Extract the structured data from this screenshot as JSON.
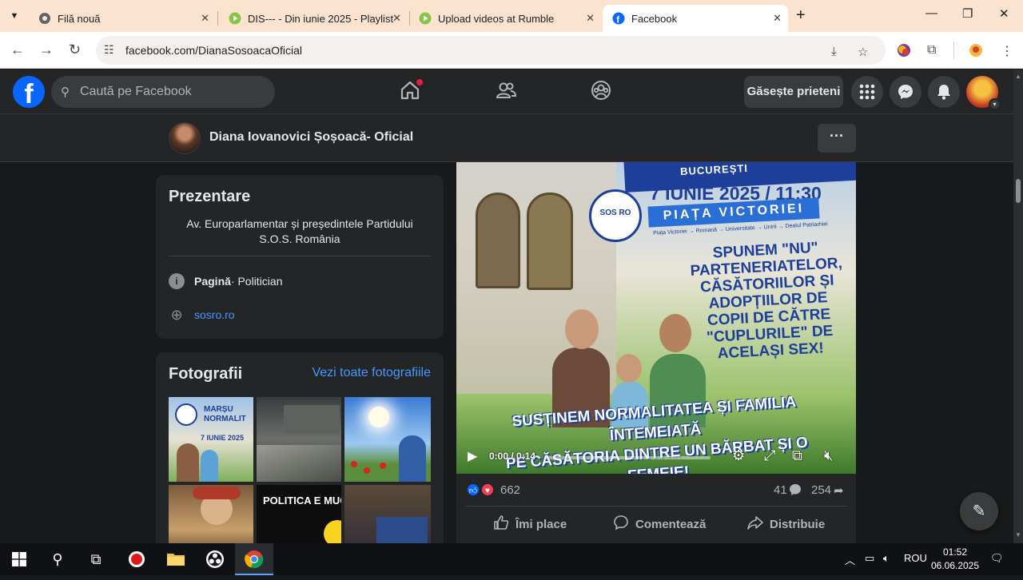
{
  "browser": {
    "tabs": [
      {
        "title": "Filă nouă"
      },
      {
        "title": "DIS--- - Din iunie 2025 - Playlist"
      },
      {
        "title": "Upload videos at Rumble"
      },
      {
        "title": "Facebook"
      }
    ],
    "url": "facebook.com/DianaSosoacaOficial"
  },
  "facebook": {
    "search_placeholder": "Caută pe Facebook",
    "find_friends_label": "Găsește prieteni"
  },
  "page": {
    "name": "Diana Iovanovici Șoșoacă- Oficial",
    "more_label": "···"
  },
  "intro": {
    "title": "Prezentare",
    "bio": "Av. Europarlamentar și președintele Partidului S.O.S. România",
    "category_bold": "Pagină",
    "category_rest": " · Politician",
    "website": "sosro.ro"
  },
  "photos": {
    "title": "Fotografii",
    "see_all": "Vezi toate fotografiile",
    "thumb1_text": "MARȘU NORMALIT",
    "thumb1_date": "7 IUNIE 2025",
    "thumb4_text": "POLITICA E MUCI"
  },
  "video": {
    "banner": "BUCUREȘTI",
    "logo_text": "SOS RO",
    "date_text": "7 IUNIE 2025 / 11:30",
    "place": "PIAȚA VICTORIEI",
    "route": "Piața Victoriei → Romană → Universitate → Unirii → Dealul Patriarhiei",
    "message": "SPUNEM \"NU\" PARTENERIATELOR, CĂSĂTORIILOR ȘI ADOPȚIILOR DE COPII DE CĂTRE \"CUPLURILE\" DE ACELAȘI SEX!",
    "bottom_line1": "SUSȚINEM NORMALITATEA ȘI FAMILIA ÎNTEMEIATĂ",
    "bottom_line2": "PE CĂSĂTORIA DINTRE UN BĂRBAT ȘI O FEMEIE!",
    "time": "0:00 / 0:14"
  },
  "post": {
    "reactions_count": "662",
    "comments_count": "41",
    "shares_count": "254",
    "like_label": "Îmi place",
    "comment_label": "Comentează",
    "share_label": "Distribuie"
  },
  "taskbar": {
    "language": "ROU",
    "time": "01:52",
    "date": "06.06.2025"
  },
  "colors": {
    "fb_blue": "#0866ff",
    "link_blue": "#4599ff",
    "surface": "#242526",
    "background": "#18191a",
    "tabbar": "#fbe3cf"
  }
}
